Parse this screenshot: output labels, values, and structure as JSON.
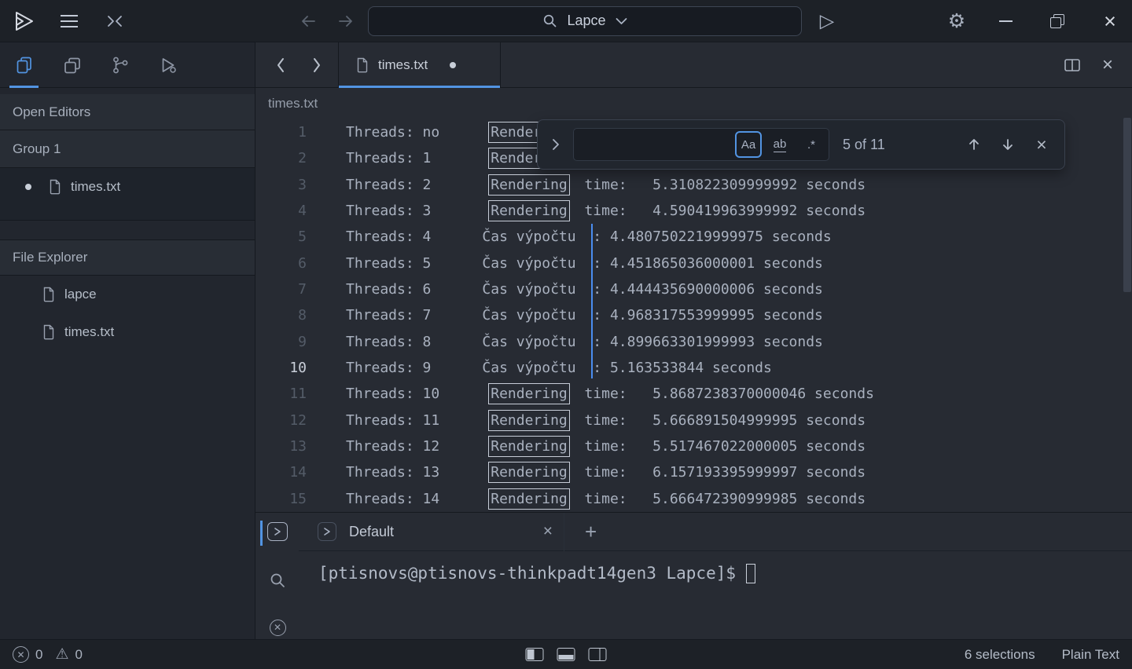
{
  "colors": {
    "accent": "#5294e2",
    "caret": "#4a8df0",
    "match_border": "#c7cdd8"
  },
  "titlebar": {
    "palette_label": "Lapce"
  },
  "sidebar": {
    "open_editors": "Open Editors",
    "group": "Group 1",
    "open_file": "times.txt",
    "file_explorer": "File Explorer",
    "files": [
      "lapce",
      "times.txt"
    ]
  },
  "tabbar": {
    "tab_label": "times.txt"
  },
  "breadcrumb": "times.txt",
  "editor_lines": [
    {
      "n": "1",
      "pre": "Threads: no      ",
      "match": "Rendering",
      "rest": ""
    },
    {
      "n": "2",
      "pre": "Threads: 1       ",
      "match": "Rendering",
      "rest": ""
    },
    {
      "n": "3",
      "pre": "Threads: 2       ",
      "match": "Rendering",
      "rest": "  time:   5.310822309999992 seconds"
    },
    {
      "n": "4",
      "pre": "Threads: 3       ",
      "match": "Rendering",
      "rest": "  time:   4.590419963999992 seconds"
    },
    {
      "n": "5",
      "pre": "Threads: 4      ",
      "plain": "Čas výpočtu",
      "rest": "  : 4.4807502219999975 seconds"
    },
    {
      "n": "6",
      "pre": "Threads: 5      ",
      "plain": "Čas výpočtu",
      "rest": "  : 4.451865036000001 seconds"
    },
    {
      "n": "7",
      "pre": "Threads: 6      ",
      "plain": "Čas výpočtu",
      "rest": "  : 4.444435690000006 seconds"
    },
    {
      "n": "8",
      "pre": "Threads: 7      ",
      "plain": "Čas výpočtu",
      "rest": "  : 4.968317553999995 seconds"
    },
    {
      "n": "9",
      "pre": "Threads: 8      ",
      "plain": "Čas výpočtu",
      "rest": "  : 4.899663301999993 seconds"
    },
    {
      "n": "10",
      "pre": "Threads: 9      ",
      "plain": "Čas výpočtu",
      "rest": "  : 5.163533844 seconds",
      "current": true
    },
    {
      "n": "11",
      "pre": "Threads: 10      ",
      "match": "Rendering",
      "rest": "  time:   5.8687238370000046 seconds"
    },
    {
      "n": "12",
      "pre": "Threads: 11      ",
      "match": "Rendering",
      "rest": "  time:   5.666891504999995 seconds"
    },
    {
      "n": "13",
      "pre": "Threads: 12      ",
      "match": "Rendering",
      "rest": "  time:   5.517467022000005 seconds"
    },
    {
      "n": "14",
      "pre": "Threads: 13      ",
      "match": "Rendering",
      "rest": "  time:   6.157193395999997 seconds"
    },
    {
      "n": "15",
      "pre": "Threads: 14      ",
      "match": "Rendering",
      "rest": "  time:   5.666472390999985 seconds"
    }
  ],
  "find": {
    "query": "",
    "case_label": "Aa",
    "word_label": "ab",
    "regex_label": ".*",
    "results": "5 of 11"
  },
  "terminal": {
    "tab_label": "Default",
    "prompt": "[ptisnovs@ptisnovs-thinkpadt14gen3 Lapce]$"
  },
  "statusbar": {
    "errors": "0",
    "warnings": "0",
    "selections": "6 selections",
    "language": "Plain Text"
  }
}
